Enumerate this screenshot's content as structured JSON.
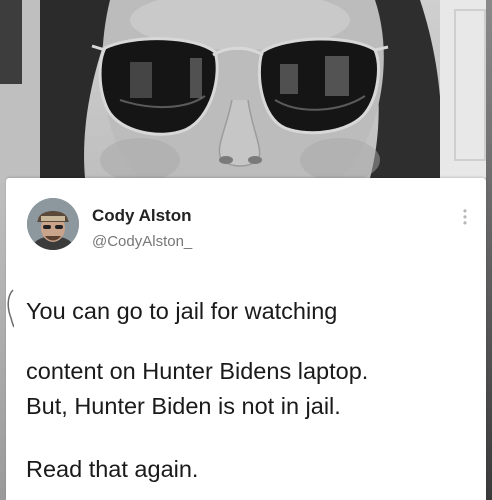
{
  "tweet": {
    "author_name": "Cody Alston",
    "author_handle": "@CodyAlston_",
    "line1": "You can go to jail for watching",
    "line2": "content on Hunter Bidens laptop.",
    "paragraph2": "But, Hunter Biden is not in jail.",
    "paragraph3": "Read that again."
  },
  "icons": {
    "menu": "more-vertical-icon",
    "avatar": "profile-avatar"
  },
  "colors": {
    "card_background": "#ffffff",
    "text": "#1a1a1a",
    "handle": "#777777"
  }
}
